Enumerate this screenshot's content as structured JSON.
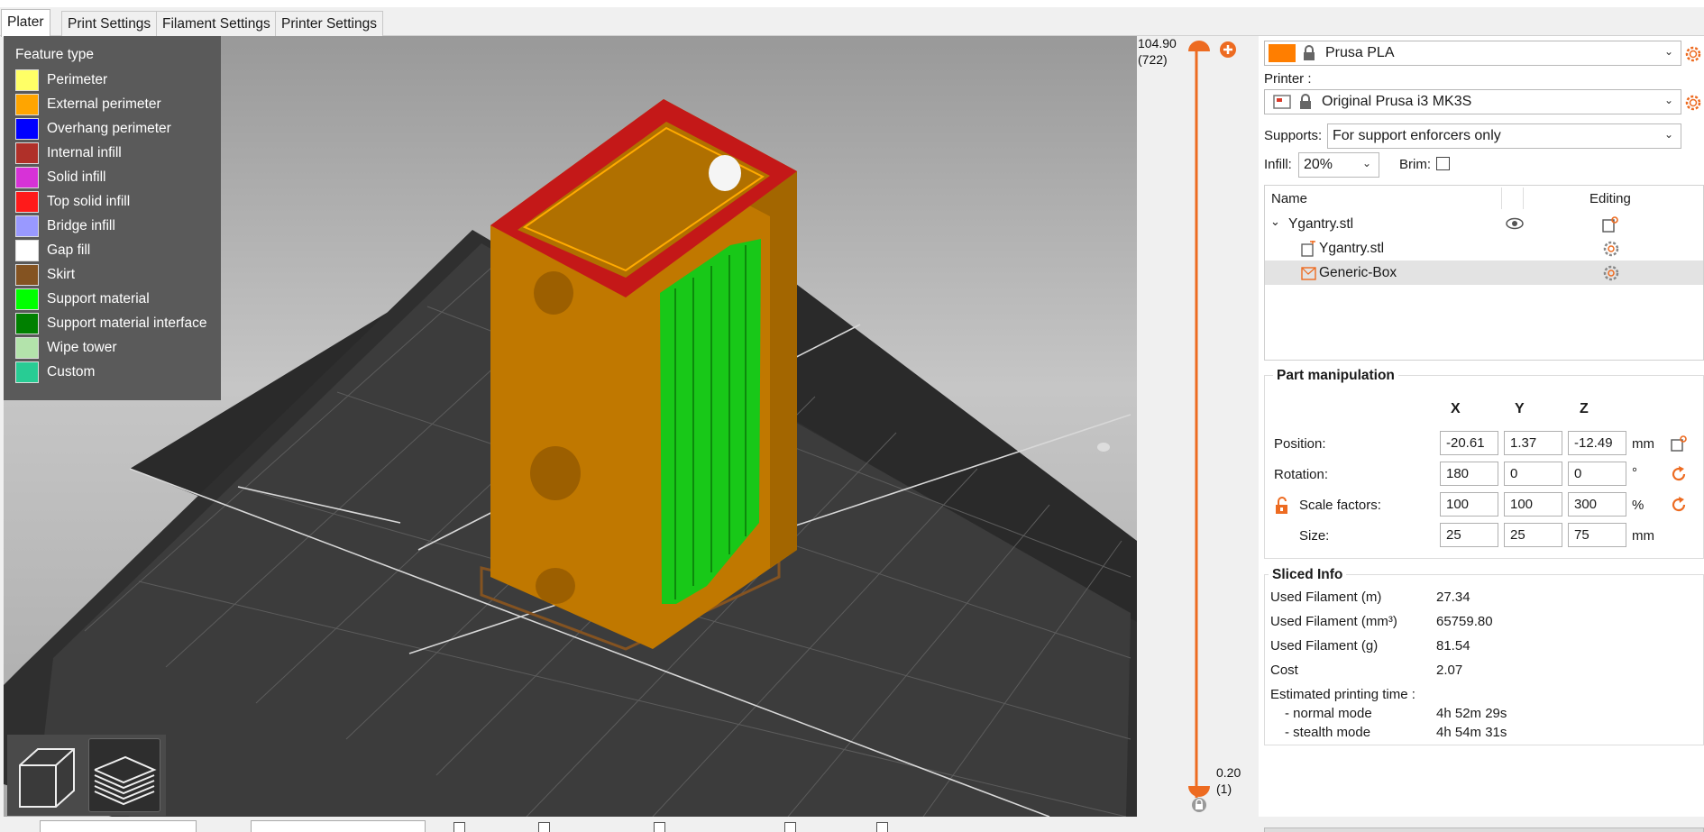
{
  "tabs": [
    "Plater",
    "Print Settings",
    "Filament Settings",
    "Printer Settings"
  ],
  "legend": {
    "title": "Feature type",
    "items": [
      {
        "label": "Perimeter",
        "color": "#FFFF66"
      },
      {
        "label": "External perimeter",
        "color": "#FFA500"
      },
      {
        "label": "Overhang perimeter",
        "color": "#0000FF"
      },
      {
        "label": "Internal infill",
        "color": "#B03029"
      },
      {
        "label": "Solid infill",
        "color": "#D732D7"
      },
      {
        "label": "Top solid infill",
        "color": "#FF1A1A"
      },
      {
        "label": "Bridge infill",
        "color": "#9999FF"
      },
      {
        "label": "Gap fill",
        "color": "#FFFFFF"
      },
      {
        "label": "Skirt",
        "color": "#845321"
      },
      {
        "label": "Support material",
        "color": "#00FF00"
      },
      {
        "label": "Support material interface",
        "color": "#008000"
      },
      {
        "label": "Wipe tower",
        "color": "#B3E3AB"
      },
      {
        "label": "Custom",
        "color": "#28CC94"
      }
    ]
  },
  "slider": {
    "top_value": "104.90",
    "top_layer": "(722)",
    "bottom_value": "0.20",
    "bottom_layer": "(1)",
    "accent": "#ED6B21"
  },
  "sidebar": {
    "filament": "Prusa PLA",
    "filament_color": "#FF7E00",
    "printer_label": "Printer :",
    "printer": "Original Prusa i3 MK3S",
    "supports_label": "Supports:",
    "supports": "For support enforcers only",
    "infill_label": "Infill:",
    "infill": "20%",
    "brim_label": "Brim:",
    "objects": {
      "col_name": "Name",
      "col_editing": "Editing",
      "rows": [
        {
          "name": "Ygantry.stl",
          "icon": "chevron-down-icon"
        },
        {
          "name": "Ygantry.stl",
          "icon": "part-icon"
        },
        {
          "name": "Generic-Box",
          "icon": "modifier-box-icon"
        }
      ]
    },
    "part_manipulation": {
      "title": "Part manipulation",
      "axes": [
        "X",
        "Y",
        "Z"
      ],
      "position": {
        "label": "Position:",
        "values": [
          "-20.61",
          "1.37",
          "-12.49"
        ],
        "unit": "mm"
      },
      "rotation": {
        "label": "Rotation:",
        "values": [
          "180",
          "0",
          "0"
        ],
        "unit": "°"
      },
      "scale": {
        "label": "Scale factors:",
        "values": [
          "100",
          "100",
          "300"
        ],
        "unit": "%"
      },
      "size": {
        "label": "Size:",
        "values": [
          "25",
          "25",
          "75"
        ],
        "unit": "mm"
      }
    },
    "sliced_info": {
      "title": "Sliced Info",
      "rows": [
        {
          "label": "Used Filament (m)",
          "value": "27.34"
        },
        {
          "label": "Used Filament (mm³)",
          "value": "65759.80"
        },
        {
          "label": "Used Filament (g)",
          "value": "81.54"
        },
        {
          "label": "Cost",
          "value": "2.07"
        }
      ],
      "time_label": "Estimated printing time :",
      "normal_label": "- normal mode",
      "normal_value": "4h 52m 29s",
      "stealth_label": "- stealth mode",
      "stealth_value": "4h 54m 31s"
    }
  }
}
